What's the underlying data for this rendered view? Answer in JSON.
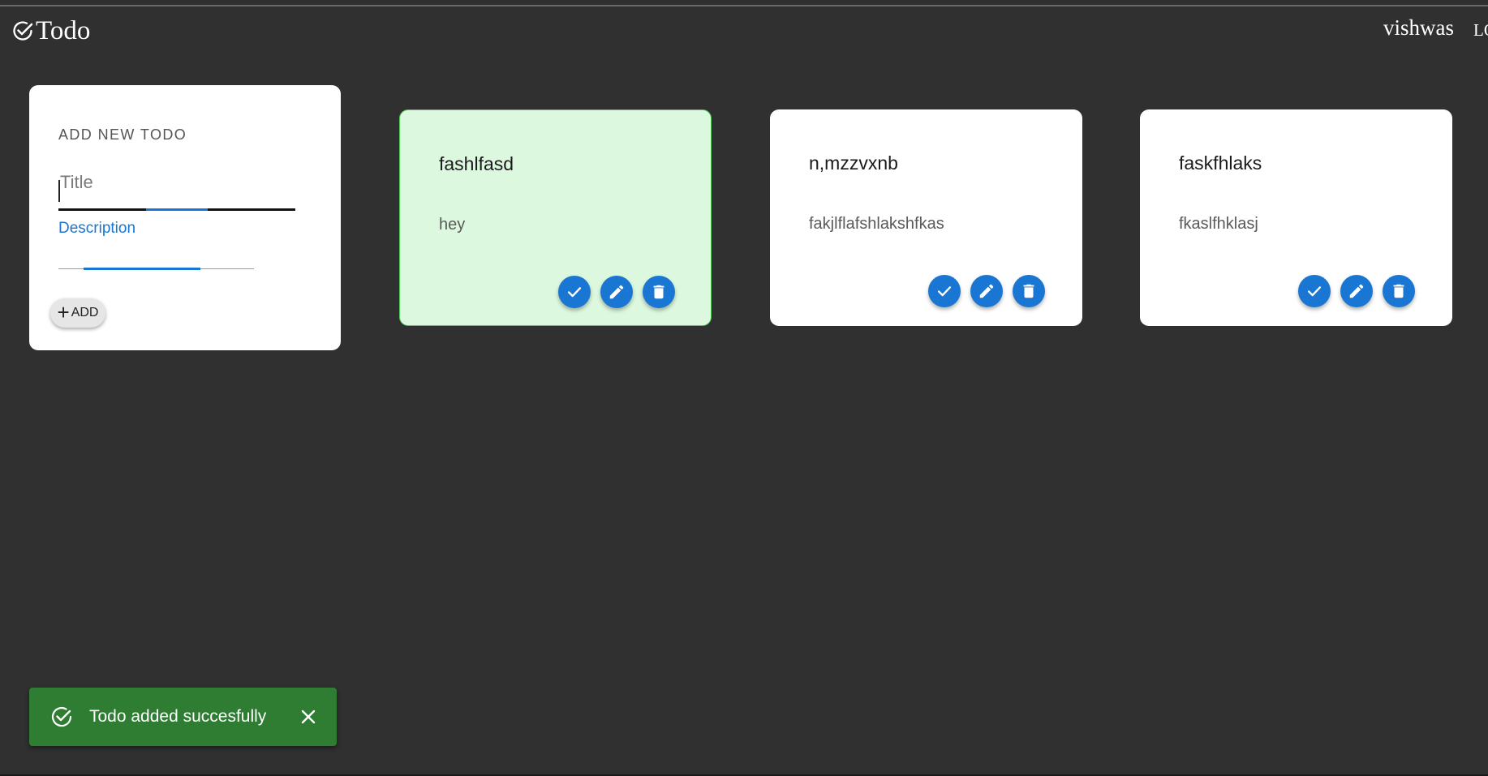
{
  "app": {
    "title": "Todo",
    "icon": "check-circle-icon"
  },
  "header": {
    "username": "vishwas",
    "logout_label": "LOGOUT"
  },
  "add_form": {
    "heading": "ADD NEW TODO",
    "title_placeholder": "Title",
    "title_value": "",
    "description_label": "Description",
    "description_value": "",
    "add_button_label": "ADD",
    "add_icon": "plus-icon",
    "accent_color": "#1976d2"
  },
  "todos": [
    {
      "title": "fashlfasd",
      "description": "hey",
      "completed": true,
      "background": "#dcf8df",
      "border": "#4ccf57"
    },
    {
      "title": "n,mzzvxnb",
      "description": "fakjlflafshlakshfkas",
      "completed": false,
      "background": "#ffffff"
    },
    {
      "title": "faskfhlaks",
      "description": "fkaslfhklasj",
      "completed": false,
      "background": "#ffffff"
    }
  ],
  "todo_actions": {
    "icons": [
      "check-icon",
      "edit-pencil-icon",
      "delete-trash-icon"
    ],
    "color": "#1976d2"
  },
  "snackbar": {
    "message": "Todo added succesfully",
    "icon": "check-circle-outline-icon",
    "close_icon": "close-icon",
    "color": "#2e7d32"
  },
  "colors": {
    "page_background": "#303030",
    "card_background": "#ffffff"
  }
}
